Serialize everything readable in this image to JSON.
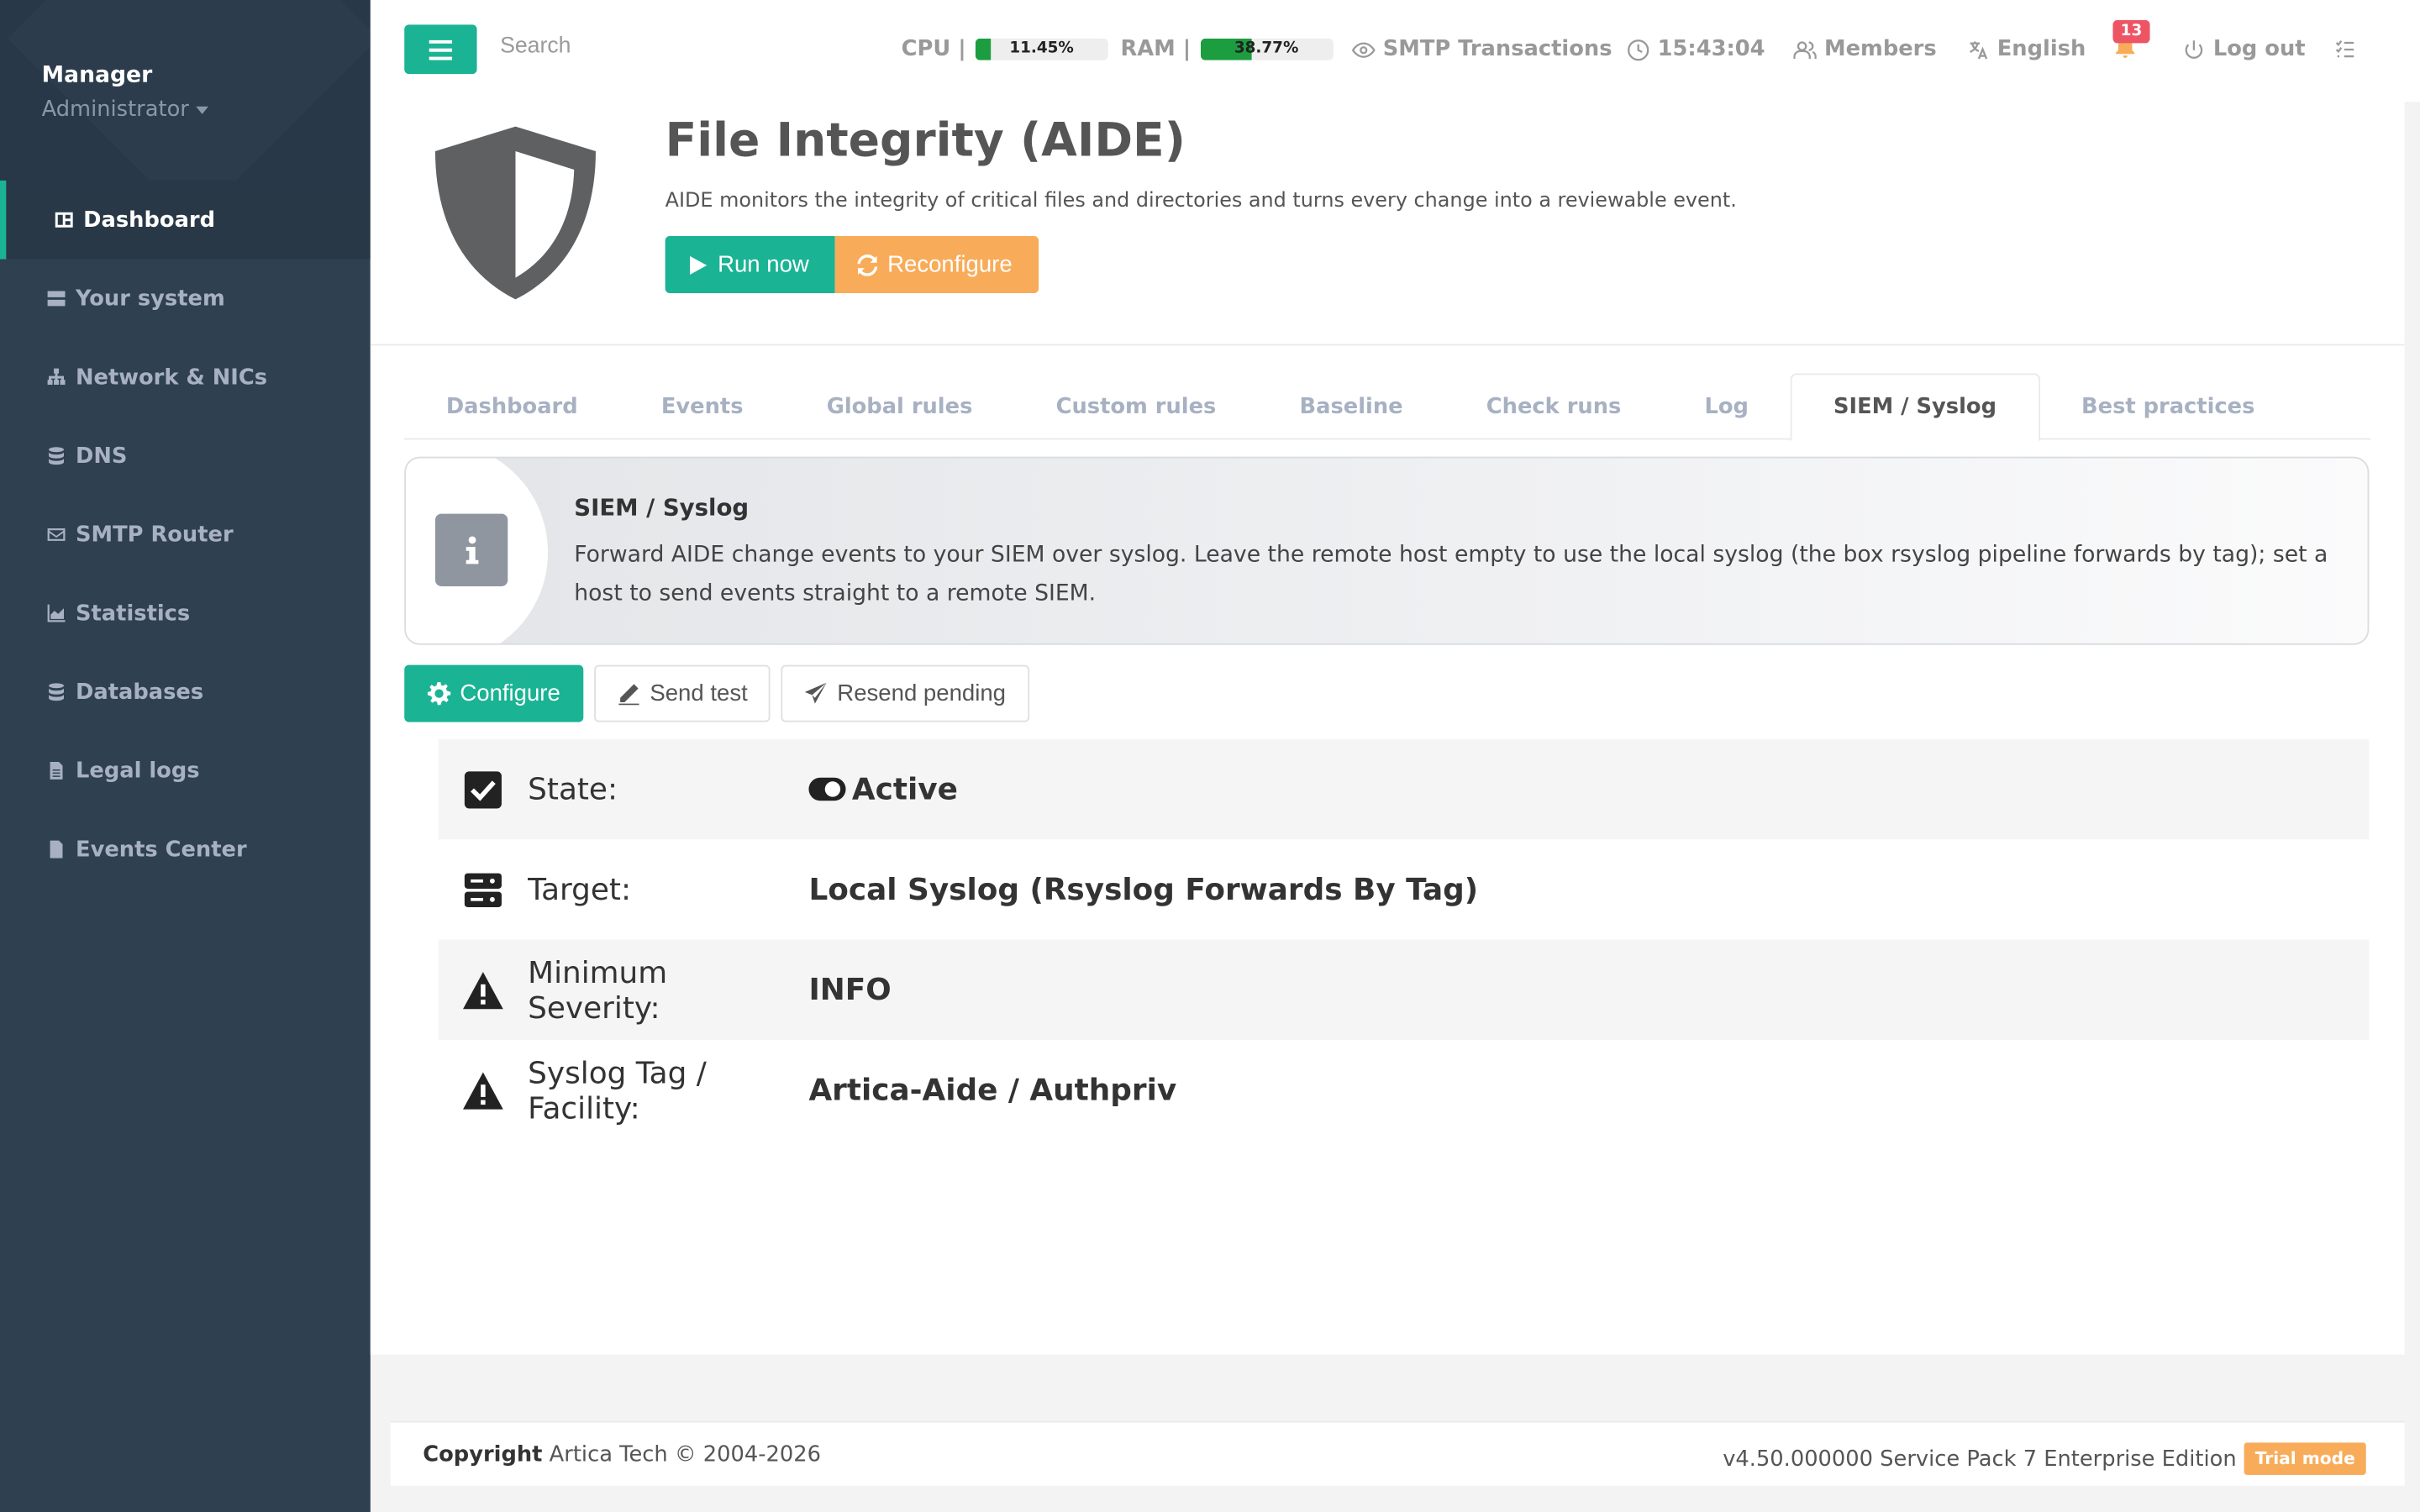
{
  "sidebar": {
    "user_name": "Manager",
    "user_role": "Administrator",
    "items": [
      {
        "label": "Dashboard",
        "icon": "dashboard-icon",
        "active": true
      },
      {
        "label": "Your system",
        "icon": "server-icon"
      },
      {
        "label": "Network & NICs",
        "icon": "sitemap-icon"
      },
      {
        "label": "DNS",
        "icon": "database-icon"
      },
      {
        "label": "SMTP Router",
        "icon": "envelope-icon"
      },
      {
        "label": "Statistics",
        "icon": "area-chart-icon"
      },
      {
        "label": "Databases",
        "icon": "database-icon"
      },
      {
        "label": "Legal logs",
        "icon": "file-icon"
      },
      {
        "label": "Events Center",
        "icon": "file-text-icon"
      }
    ]
  },
  "topbar": {
    "search_placeholder": "Search",
    "cpu_label": "CPU |",
    "cpu_value": "11.45%",
    "cpu_fraction": 0.1145,
    "ram_label": "RAM |",
    "ram_value": "38.77%",
    "ram_fraction": 0.3877,
    "smtp_transactions": "SMTP Transactions",
    "clock": "15:43:04",
    "members": "Members",
    "language": "English",
    "notifications_count": "13",
    "logout": "Log out"
  },
  "header": {
    "title": "File Integrity (AIDE)",
    "description": "AIDE monitors the integrity of critical files and directories and turns every change into a reviewable event.",
    "run_now": "Run now",
    "reconfigure": "Reconfigure"
  },
  "tabs": [
    {
      "label": "Dashboard"
    },
    {
      "label": "Events"
    },
    {
      "label": "Global rules"
    },
    {
      "label": "Custom rules"
    },
    {
      "label": "Baseline"
    },
    {
      "label": "Check runs"
    },
    {
      "label": "Log"
    },
    {
      "label": "SIEM / Syslog",
      "active": true
    },
    {
      "label": "Best practices"
    }
  ],
  "info": {
    "title": "SIEM / Syslog",
    "text": "Forward AIDE change events to your SIEM over syslog. Leave the remote host empty to use the local syslog (the box rsyslog pipeline forwards by tag); set a host to send events straight to a remote SIEM."
  },
  "actions": {
    "configure": "Configure",
    "send_test": "Send test",
    "resend_pending": "Resend pending"
  },
  "settings": {
    "state_label": "State:",
    "state_value": "Active",
    "target_label": "Target:",
    "target_value": "Local Syslog (Rsyslog Forwards By Tag)",
    "severity_label": "Minimum Severity:",
    "severity_value": "INFO",
    "tag_label": "Syslog Tag / Facility:",
    "tag_value": "Artica-Aide / Authpriv"
  },
  "footer": {
    "copyright_bold": "Copyright",
    "copyright_text": "Artica Tech © 2004-2026",
    "version": "v4.50.000000 Service Pack 7 Enterprise Edition",
    "trial": "Trial mode"
  },
  "colors": {
    "accent": "#1ab394",
    "warning": "#f8ac59",
    "danger": "#ed5565",
    "sidebar": "#2f4050",
    "meter": "#1c9d3f"
  }
}
